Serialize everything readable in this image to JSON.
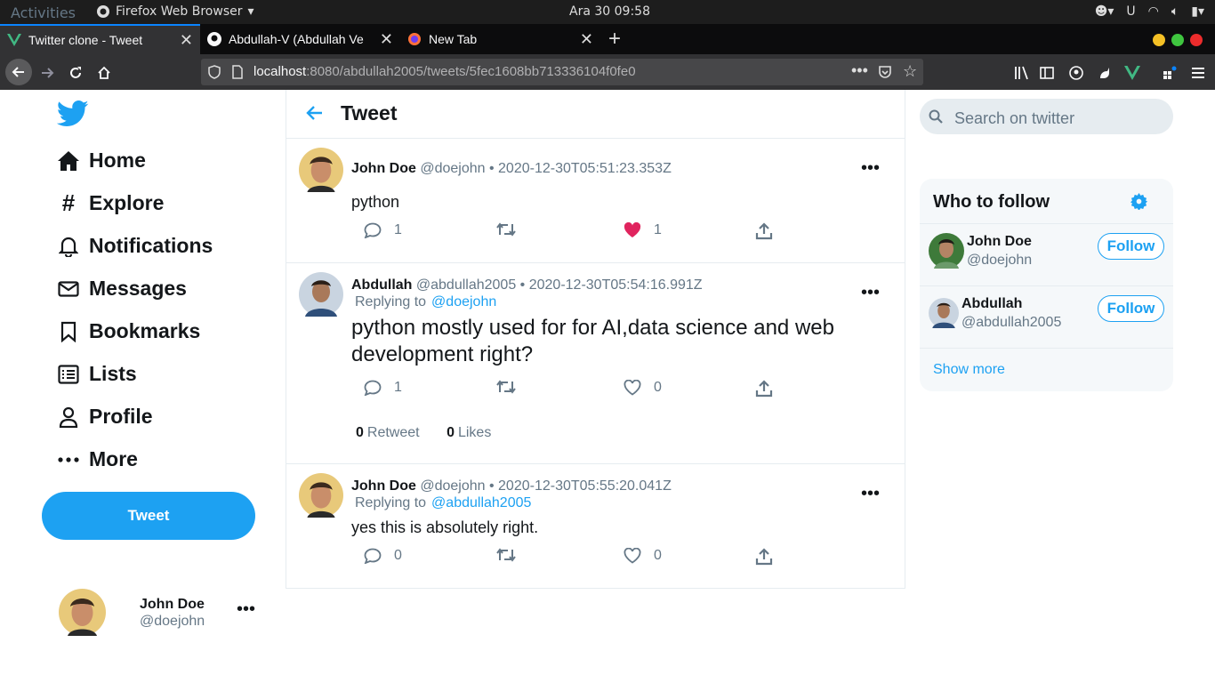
{
  "os": {
    "activities": "Activities",
    "app_name": "Firefox Web Browser",
    "clock": "Ara 30  09:58"
  },
  "browser": {
    "tabs": [
      {
        "title": "Twitter clone - Tweet",
        "icon": "vue-icon",
        "active": true
      },
      {
        "title": "Abdullah-V (Abdullah Ve",
        "icon": "github-icon",
        "active": false
      },
      {
        "title": "New Tab",
        "icon": "firefox-icon",
        "active": false
      }
    ],
    "url_host": "localhost",
    "url_rest": ":8080/abdullah2005/tweets/5fec1608bb713336104f0fe0"
  },
  "sidebar": {
    "items": [
      {
        "label": "Home",
        "icon": "home-icon"
      },
      {
        "label": "Explore",
        "icon": "hash-icon"
      },
      {
        "label": "Notifications",
        "icon": "bell-icon"
      },
      {
        "label": "Messages",
        "icon": "mail-icon"
      },
      {
        "label": "Bookmarks",
        "icon": "bookmark-icon"
      },
      {
        "label": "Lists",
        "icon": "list-icon"
      },
      {
        "label": "Profile",
        "icon": "user-icon"
      },
      {
        "label": "More",
        "icon": "dots-icon"
      }
    ],
    "tweet_button": "Tweet",
    "current_user": {
      "name": "John Doe",
      "handle": "@doejohn"
    }
  },
  "main": {
    "title": "Tweet",
    "tweets": [
      {
        "name": "John Doe",
        "handle": "@doejohn",
        "date": "2020-12-30T05:51:23.353Z",
        "replying_to": "",
        "text": "python",
        "replies": "1",
        "likes": "1",
        "liked": true
      },
      {
        "name": "Abdullah",
        "handle": "@abdullah2005",
        "date": "2020-12-30T05:54:16.991Z",
        "replying_to": "@doejohn",
        "text": "python mostly used for for AI,data science and web development right?",
        "replies": "1",
        "likes": "0",
        "liked": false,
        "retweet_count": "0",
        "retweet_label": "Retweet",
        "likes_count": "0",
        "likes_label": "Likes"
      },
      {
        "name": "John Doe",
        "handle": "@doejohn",
        "date": "2020-12-30T05:55:20.041Z",
        "replying_to": "@abdullah2005",
        "text": "yes this is absolutely right.",
        "replies": "0",
        "likes": "0",
        "liked": false
      }
    ],
    "replying_label": "Replying to"
  },
  "right": {
    "search_placeholder": "Search on twitter",
    "who_to_follow": "Who to follow",
    "follow_suggestions": [
      {
        "name": "John Doe",
        "handle": "@doejohn",
        "button": "Follow"
      },
      {
        "name": "Abdullah",
        "handle": "@abdullah2005",
        "button": "Follow"
      }
    ],
    "show_more": "Show more"
  },
  "colors": {
    "accent": "#1da1f2",
    "like": "#e0245e",
    "text": "#14171a",
    "muted": "#657786"
  }
}
